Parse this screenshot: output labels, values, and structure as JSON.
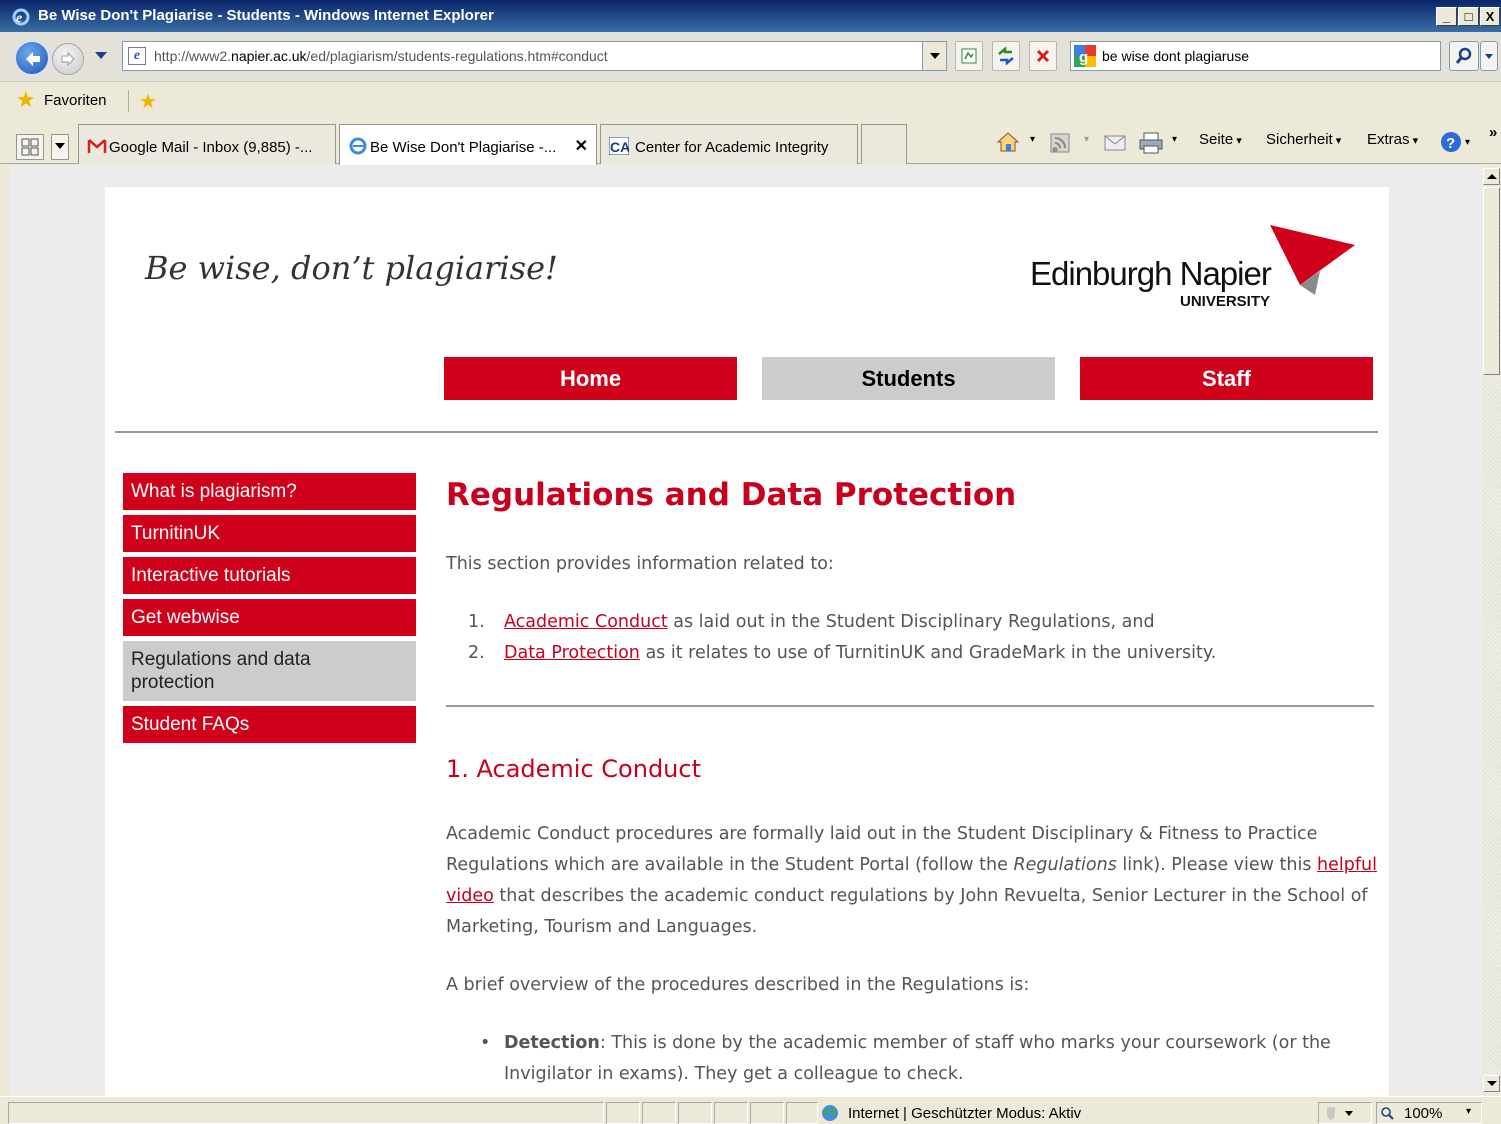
{
  "window": {
    "title": "Be Wise Don't Plagiarise - Students - Windows Internet Explorer",
    "minimize": "_",
    "maximize": "□",
    "close": "X"
  },
  "address": {
    "url_prefix": "http://www2.",
    "url_domain": "napier.ac.uk",
    "url_suffix": "/ed/plagiarism/students-regulations.htm#conduct",
    "search_query": "be wise dont plagiaruse"
  },
  "favorites": {
    "label": "Favoriten"
  },
  "tabs": [
    {
      "label": "Google Mail - Inbox (9,885) -...",
      "icon": "gmail-icon",
      "active": false
    },
    {
      "label": "Be Wise Don't Plagiarise -...",
      "icon": "ie-icon",
      "active": true,
      "close": "✕"
    },
    {
      "label": "Center for Academic Integrity",
      "icon": "cai-icon",
      "active": false
    }
  ],
  "commands": {
    "page": "Seite",
    "safety": "Sicherheit",
    "tools": "Extras",
    "more": "»"
  },
  "page": {
    "tagline": "Be wise, don’t plagiarise!",
    "logo_name": "Edinburgh Napier",
    "logo_sub": "UNIVERSITY",
    "brand_color": "#d0021b",
    "main_nav": [
      {
        "label": "Home",
        "current": false
      },
      {
        "label": "Students",
        "current": true
      },
      {
        "label": "Staff",
        "current": false
      }
    ],
    "sidebar": [
      {
        "label": "What is plagiarism?",
        "current": false
      },
      {
        "label": "TurnitinUK",
        "current": false
      },
      {
        "label": "Interactive tutorials",
        "current": false
      },
      {
        "label": "Get webwise",
        "current": false
      },
      {
        "label": "Regulations and data protection",
        "current": true
      },
      {
        "label": "Student FAQs",
        "current": false
      }
    ],
    "heading": "Regulations and Data Protection",
    "intro": "This section provides information related to:",
    "list": [
      {
        "num": "1.",
        "link": "Academic Conduct",
        "rest": " as laid out in the Student Disciplinary Regulations, and"
      },
      {
        "num": "2.",
        "link": "Data Protection",
        "rest": " as it relates to use of TurnitinUK and GradeMark in the university."
      }
    ],
    "section_heading": "1. Academic Conduct",
    "para1_a": "Academic Conduct procedures are formally laid out in the Student Disciplinary & Fitness to Practice Regulations which are available in the Student Portal (follow the ",
    "para1_em": "Regulations",
    "para1_b": " link). Please view this ",
    "para1_link": "helpful video",
    "para1_c": " that describes the academic conduct regulations by John Revuelta, Senior Lecturer in the School of Marketing, Tourism and Languages.",
    "para2": "A brief overview of the procedures described in the Regulations is:",
    "bullet_bold": "Detection",
    "bullet_text": ": This is done by the academic member of staff who marks your coursework (or the Invigilator in exams). They get a colleague to check."
  },
  "status": {
    "zone": "Internet | Geschützter Modus: Aktiv",
    "zoom": "100%"
  }
}
